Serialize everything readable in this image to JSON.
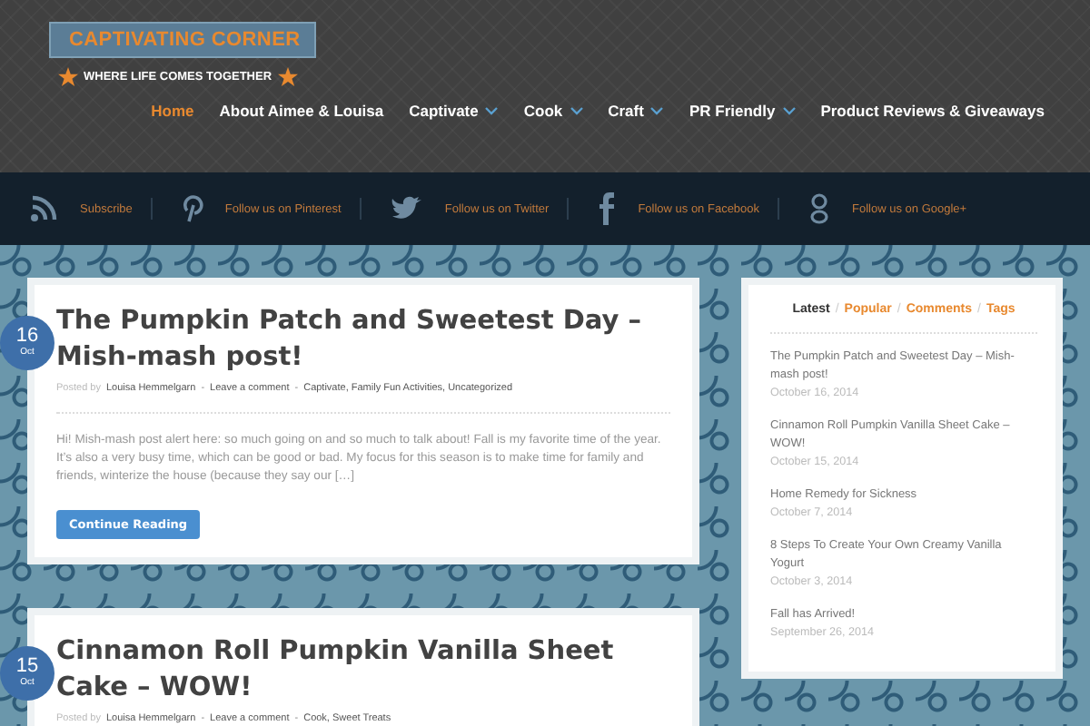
{
  "logo": {
    "title": "CAPTIVATING CORNER",
    "tagline": "WHERE LIFE COMES TOGETHER"
  },
  "nav": [
    {
      "label": "Home",
      "selected": true,
      "has_menu": false
    },
    {
      "label": "About Aimee & Louisa",
      "selected": false,
      "has_menu": false
    },
    {
      "label": "Captivate",
      "selected": false,
      "has_menu": true
    },
    {
      "label": "Cook",
      "selected": false,
      "has_menu": true
    },
    {
      "label": "Craft",
      "selected": false,
      "has_menu": true
    },
    {
      "label": "PR Friendly",
      "selected": false,
      "has_menu": true
    },
    {
      "label": "Product Reviews & Giveaways",
      "selected": false,
      "has_menu": false
    }
  ],
  "social": [
    {
      "kind": "rss",
      "label": "Subscribe"
    },
    {
      "kind": "pinterest",
      "label": "Follow us on Pinterest"
    },
    {
      "kind": "twitter",
      "label": "Follow us on Twitter"
    },
    {
      "kind": "facebook",
      "label": "Follow us on Facebook"
    },
    {
      "kind": "google",
      "label": "Follow us on Google+"
    }
  ],
  "posts": [
    {
      "day": "16",
      "month": "Oct",
      "title": "The Pumpkin Patch and Sweetest Day – Mish-mash post!",
      "meta": [
        {
          "kind": "text",
          "text": "Posted by"
        },
        {
          "kind": "link",
          "text": "Louisa Hemmelgarn"
        },
        {
          "kind": "sep",
          "text": "-"
        },
        {
          "kind": "link",
          "text": "Leave a comment"
        },
        {
          "kind": "sep",
          "text": "-"
        },
        {
          "kind": "link",
          "text": "Captivate, Family Fun Activities, Uncategorized"
        }
      ],
      "excerpt": "Hi! Mish-mash post alert here: so much going on and so much to talk about! Fall is my favorite time of the year. It’s also a very busy time, which can be good or bad. My focus for this season is to make time for family and friends, winterize the house (because they say our […]",
      "button": "Continue Reading"
    },
    {
      "day": "15",
      "month": "Oct",
      "title": "Cinnamon Roll Pumpkin Vanilla Sheet Cake – WOW!",
      "meta": [
        {
          "kind": "text",
          "text": "Posted by"
        },
        {
          "kind": "link",
          "text": "Louisa Hemmelgarn"
        },
        {
          "kind": "sep",
          "text": "-"
        },
        {
          "kind": "link",
          "text": "Leave a comment"
        },
        {
          "kind": "sep",
          "text": "-"
        },
        {
          "kind": "link",
          "text": "Cook, Sweet Treats"
        }
      ]
    }
  ],
  "sidebar": {
    "tabs": [
      {
        "label": "Latest",
        "selected": true
      },
      {
        "separator": "/",
        "label": "Popular",
        "selected": false
      },
      {
        "separator": "/",
        "label": "Comments",
        "selected": false
      },
      {
        "separator": "/",
        "label": "Tags",
        "selected": false
      }
    ],
    "items": [
      {
        "title": "The Pumpkin Patch and Sweetest Day – Mish-mash post!",
        "date": "October 16, 2014"
      },
      {
        "title": "Cinnamon Roll Pumpkin Vanilla Sheet Cake – WOW!",
        "date": "October 15, 2014"
      },
      {
        "title": "Home Remedy for Sickness",
        "date": "October 7, 2014"
      },
      {
        "title": "8 Steps To Create Your Own Creamy Vanilla Yogurt",
        "date": "October 3, 2014"
      },
      {
        "title": "Fall has Arrived!",
        "date": "September 26, 2014"
      }
    ]
  }
}
